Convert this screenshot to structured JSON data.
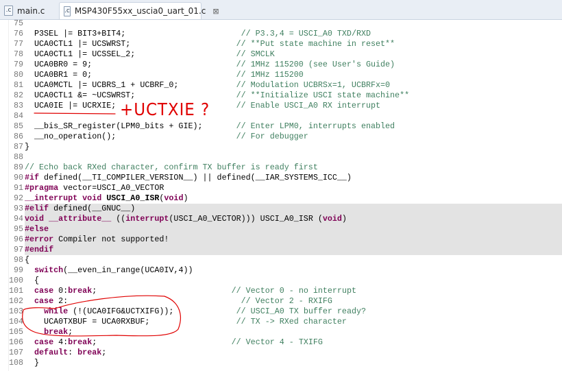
{
  "tabs": [
    {
      "label": "main.c",
      "icon": "c-file-icon",
      "active": false
    },
    {
      "label": "MSP430F55xx_uscia0_uart_01.c",
      "icon": "c-file-icon",
      "active": true
    }
  ],
  "annotation": {
    "text": "+UCTXIE ?",
    "color": "#e00000"
  },
  "highlight_lines": [
    93,
    94,
    95,
    96,
    97
  ],
  "lines": [
    {
      "n": "75",
      "s": []
    },
    {
      "n": "76",
      "s": [
        [
          "",
          "  P3SEL |= BIT3+BIT4;                        "
        ],
        [
          "cm",
          "// P3.3,4 = USCI_A0 TXD/RXD"
        ]
      ]
    },
    {
      "n": "77",
      "s": [
        [
          "",
          "  UCA0CTL1 |= UCSWRST;                      "
        ],
        [
          "cm",
          "// **Put state machine in reset**"
        ]
      ]
    },
    {
      "n": "78",
      "s": [
        [
          "",
          "  UCA0CTL1 |= UCSSEL_2;                     "
        ],
        [
          "cm",
          "// SMCLK"
        ]
      ]
    },
    {
      "n": "79",
      "s": [
        [
          "",
          "  UCA0BR0 = 9;                              "
        ],
        [
          "cm",
          "// 1MHz 115200 (see User's Guide)"
        ]
      ]
    },
    {
      "n": "80",
      "s": [
        [
          "",
          "  UCA0BR1 = 0;                              "
        ],
        [
          "cm",
          "// 1MHz 115200"
        ]
      ]
    },
    {
      "n": "81",
      "s": [
        [
          "",
          "  UCA0MCTL |= UCBRS_1 + UCBRF_0;            "
        ],
        [
          "cm",
          "// Modulation UCBRSx=1, UCBRFx=0"
        ]
      ]
    },
    {
      "n": "82",
      "s": [
        [
          "",
          "  UCA0CTL1 &= ~UCSWRST;                     "
        ],
        [
          "cm",
          "// **Initialize USCI state machine**"
        ]
      ]
    },
    {
      "n": "83",
      "s": [
        [
          "",
          "  UCA0IE |= UCRXIE;                         "
        ],
        [
          "cm",
          "// Enable USCI_A0 RX interrupt"
        ]
      ]
    },
    {
      "n": "84",
      "s": []
    },
    {
      "n": "85",
      "s": [
        [
          "",
          "  __bis_SR_register(LPM0_bits + GIE);       "
        ],
        [
          "cm",
          "// Enter LPM0, interrupts enabled"
        ]
      ]
    },
    {
      "n": "86",
      "s": [
        [
          "",
          "  __no_operation();                         "
        ],
        [
          "cm",
          "// For debugger"
        ]
      ]
    },
    {
      "n": "87",
      "s": [
        [
          "",
          "}"
        ]
      ]
    },
    {
      "n": "88",
      "s": []
    },
    {
      "n": "89",
      "s": [
        [
          "cm",
          "// Echo back RXed character, confirm TX buffer is ready first"
        ]
      ]
    },
    {
      "n": "90",
      "s": [
        [
          "kw",
          "#if"
        ],
        [
          "",
          " defined(__TI_COMPILER_VERSION__) || defined(__IAR_SYSTEMS_ICC__)"
        ]
      ]
    },
    {
      "n": "91",
      "s": [
        [
          "kw",
          "#pragma"
        ],
        [
          "",
          " vector=USCI_A0_VECTOR"
        ]
      ]
    },
    {
      "n": "92",
      "s": [
        [
          "kw",
          "__interrupt void"
        ],
        [
          "",
          " "
        ],
        [
          "b",
          "USCI_A0_ISR"
        ],
        [
          "",
          "("
        ],
        [
          "kw",
          "void"
        ],
        [
          "",
          ")"
        ]
      ]
    },
    {
      "n": "93",
      "s": [
        [
          "kw",
          "#elif"
        ],
        [
          "",
          " defined(__GNUC__)"
        ]
      ]
    },
    {
      "n": "94",
      "s": [
        [
          "kw",
          "void __attribute__"
        ],
        [
          "",
          " (("
        ],
        [
          "kw",
          "interrupt"
        ],
        [
          "",
          "(USCI_A0_VECTOR))) USCI_A0_ISR ("
        ],
        [
          "kw",
          "void"
        ],
        [
          "",
          ")"
        ]
      ]
    },
    {
      "n": "95",
      "s": [
        [
          "kw",
          "#else"
        ]
      ]
    },
    {
      "n": "96",
      "s": [
        [
          "kw",
          "#error"
        ],
        [
          "",
          " Compiler not supported!"
        ]
      ]
    },
    {
      "n": "97",
      "s": [
        [
          "kw",
          "#endif"
        ]
      ]
    },
    {
      "n": "98",
      "s": [
        [
          "",
          "{"
        ]
      ]
    },
    {
      "n": "99",
      "s": [
        [
          "",
          "  "
        ],
        [
          "kw",
          "switch"
        ],
        [
          "",
          "(__even_in_range(UCA0IV,4))"
        ]
      ]
    },
    {
      "n": "100",
      "s": [
        [
          "",
          "  {"
        ]
      ]
    },
    {
      "n": "101",
      "s": [
        [
          "",
          "  "
        ],
        [
          "kw",
          "case"
        ],
        [
          "",
          " 0:"
        ],
        [
          "kw",
          "break"
        ],
        [
          "",
          ";                            "
        ],
        [
          "cm",
          "// Vector 0 - no interrupt"
        ]
      ]
    },
    {
      "n": "102",
      "s": [
        [
          "",
          "  "
        ],
        [
          "kw",
          "case"
        ],
        [
          "",
          " 2:                                    "
        ],
        [
          "cm",
          "// Vector 2 - RXIFG"
        ]
      ]
    },
    {
      "n": "103",
      "s": [
        [
          "",
          "    "
        ],
        [
          "kw",
          "while"
        ],
        [
          "",
          " (!(UCA0IFG&UCTXIFG));             "
        ],
        [
          "cm",
          "// USCI_A0 TX buffer ready?"
        ]
      ]
    },
    {
      "n": "104",
      "s": [
        [
          "",
          "    UCA0TXBUF = UCA0RXBUF;                  "
        ],
        [
          "cm",
          "// TX -> RXed character"
        ]
      ]
    },
    {
      "n": "105",
      "s": [
        [
          "",
          "    "
        ],
        [
          "kw",
          "break"
        ],
        [
          "",
          ";"
        ]
      ]
    },
    {
      "n": "106",
      "s": [
        [
          "",
          "  "
        ],
        [
          "kw",
          "case"
        ],
        [
          "",
          " 4:"
        ],
        [
          "kw",
          "break"
        ],
        [
          "",
          ";                            "
        ],
        [
          "cm",
          "// Vector 4 - TXIFG"
        ]
      ]
    },
    {
      "n": "107",
      "s": [
        [
          "",
          "  "
        ],
        [
          "kw",
          "default"
        ],
        [
          "",
          ": "
        ],
        [
          "kw",
          "break"
        ],
        [
          "",
          ";"
        ]
      ]
    },
    {
      "n": "108",
      "s": [
        [
          "",
          "  }"
        ]
      ]
    }
  ]
}
